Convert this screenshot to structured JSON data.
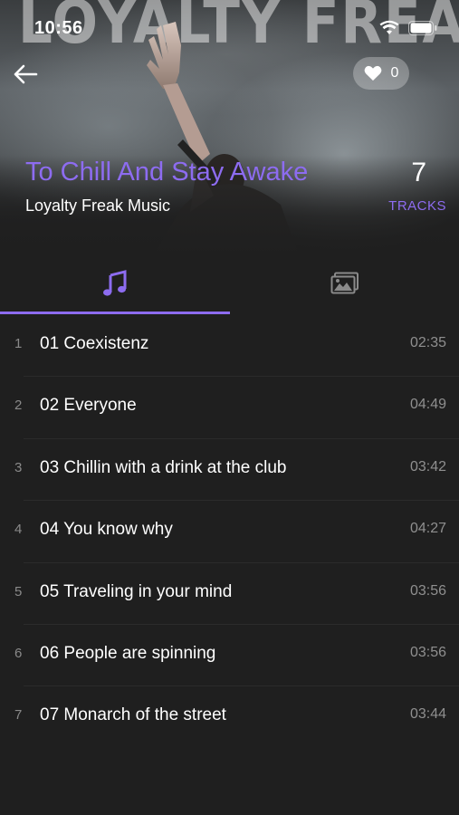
{
  "status_bar": {
    "time": "10:56"
  },
  "hero": {
    "background_text": "LOYALTY FREAK MUSIC"
  },
  "header": {
    "back_icon": "arrow-left-icon",
    "like_icon": "heart-icon",
    "like_count": "0"
  },
  "album": {
    "title": "To Chill And Stay Awake",
    "artist": "Loyalty Freak Music",
    "track_count": "7",
    "track_count_label": "TRACKS"
  },
  "tabs": [
    {
      "name": "tracks",
      "icon": "music-note-icon",
      "active": true
    },
    {
      "name": "gallery",
      "icon": "gallery-icon",
      "active": false
    }
  ],
  "tracks": [
    {
      "index": "1",
      "title": "01 Coexistenz",
      "duration": "02:35"
    },
    {
      "index": "2",
      "title": "02 Everyone",
      "duration": "04:49"
    },
    {
      "index": "3",
      "title": "03 Chillin with a drink at the club",
      "duration": "03:42"
    },
    {
      "index": "4",
      "title": "04 You know why",
      "duration": "04:27"
    },
    {
      "index": "5",
      "title": "05 Traveling in your mind",
      "duration": "03:56"
    },
    {
      "index": "6",
      "title": "06 People are spinning",
      "duration": "03:56"
    },
    {
      "index": "7",
      "title": "07 Monarch of the street",
      "duration": "03:44"
    }
  ],
  "colors": {
    "accent": "#8d6cf0",
    "background": "#1f1f1f",
    "text": "#ffffff",
    "muted": "#8f8f8f"
  }
}
